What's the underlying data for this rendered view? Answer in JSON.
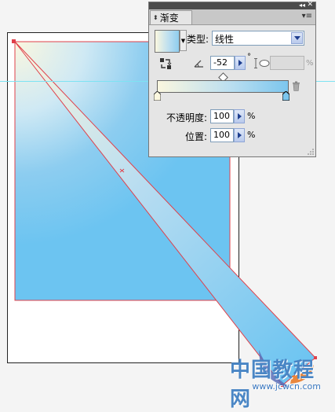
{
  "panel": {
    "tab_label": "渐变",
    "type_label": "类型:",
    "type_value": "线性",
    "angle_value": "-52",
    "degree_symbol": "°",
    "aspect_ratio_value": "",
    "aspect_unit": "%",
    "opacity_label": "不透明度:",
    "opacity_value": "100",
    "opacity_unit": "%",
    "location_label": "位置:",
    "location_value": "100",
    "location_unit": "%",
    "topbar_collapse": "◂◂",
    "topbar_close": "✕",
    "menu_icon": "▾≡"
  },
  "gradient": {
    "start_color": "#fbf7df",
    "end_color": "#7cc6ee",
    "angle_deg": -52
  },
  "canvas": {
    "guide_color": "#7de3f3",
    "annotator_color": "#e0404a"
  },
  "watermark": {
    "top_text": "中国教程网",
    "bottom_text": "www.jcwcn.com"
  },
  "icons": {
    "reverse": "reverse-gradient-icon",
    "angle": "angle-icon",
    "aspect": "aspect-ratio-icon",
    "delete_stop": "trash-icon"
  }
}
